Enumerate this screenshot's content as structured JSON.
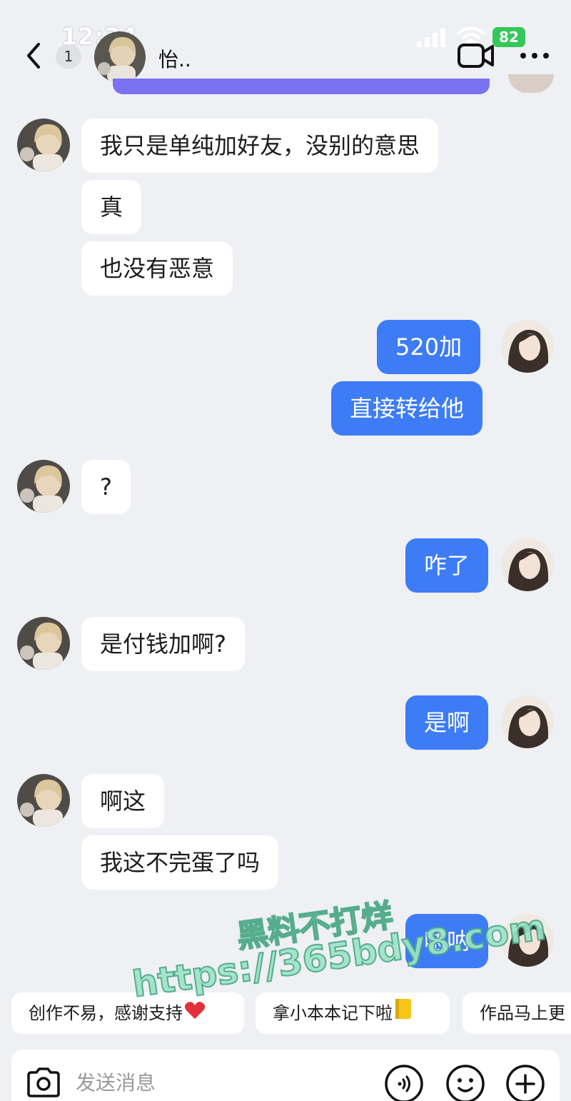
{
  "status_bar": {
    "time": "12:34",
    "battery": "82"
  },
  "header": {
    "unread_count": "1",
    "contact_name": "怡.."
  },
  "messages": [
    {
      "text": "我只是单纯加好友，没别的意思"
    },
    {
      "text": "真"
    },
    {
      "text": "也没有恶意"
    },
    {
      "text": "520加"
    },
    {
      "text": "直接转给他"
    },
    {
      "text": "?"
    },
    {
      "text": "咋了"
    },
    {
      "text": "是付钱加啊?"
    },
    {
      "text": "是啊"
    },
    {
      "text": "啊这"
    },
    {
      "text": "我这不完蛋了吗"
    },
    {
      "text": "嗯呐"
    }
  ],
  "quick_replies": [
    {
      "label": "创作不易，感谢支持",
      "emoji": "heart"
    },
    {
      "label": "拿小本本记下啦",
      "emoji": "notebook"
    },
    {
      "label": "作品马上更"
    }
  ],
  "input": {
    "placeholder": "发送消息"
  },
  "watermark": {
    "line1": "黑料不打烊",
    "line2": "https://365bdy8.com"
  },
  "colors": {
    "outgoing_bubble": "#3d7cf5",
    "incoming_bubble": "#ffffff",
    "background": "#eef0f3",
    "battery": "#34c759"
  }
}
